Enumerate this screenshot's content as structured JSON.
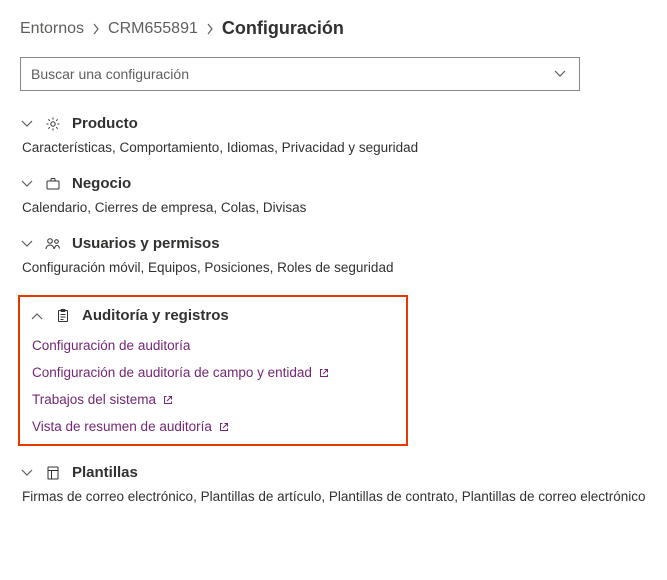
{
  "breadcrumb": {
    "root": "Entornos",
    "env": "CRM655891",
    "current": "Configuración"
  },
  "search": {
    "placeholder": "Buscar una configuración"
  },
  "sections": {
    "product": {
      "title": "Producto",
      "desc": "Características, Comportamiento, Idiomas, Privacidad y seguridad"
    },
    "business": {
      "title": "Negocio",
      "desc": "Calendario, Cierres de empresa, Colas, Divisas"
    },
    "users": {
      "title": "Usuarios y permisos",
      "desc": "Configuración móvil, Equipos, Posiciones, Roles de seguridad"
    },
    "audit": {
      "title": "Auditoría y registros",
      "links": {
        "l0": "Configuración de auditoría",
        "l1": "Configuración de auditoría de campo y entidad",
        "l2": "Trabajos del sistema",
        "l3": "Vista de resumen de auditoría"
      }
    },
    "templates": {
      "title": "Plantillas",
      "desc": "Firmas de correo electrónico, Plantillas de artículo, Plantillas de contrato, Plantillas de correo electrónico"
    }
  }
}
